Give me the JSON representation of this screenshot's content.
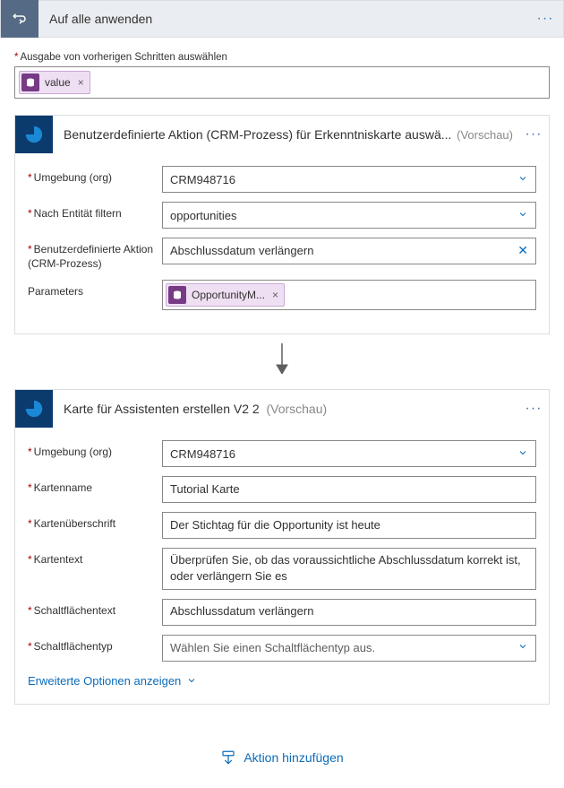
{
  "outer": {
    "title": "Auf alle anwenden",
    "prev_output_label": "Ausgabe von vorherigen Schritten auswählen",
    "token_label": "value"
  },
  "card1": {
    "title": "Benutzerdefinierte Aktion (CRM-Prozess) für Erkenntniskarte auswä...",
    "preview": "(Vorschau)",
    "env_label": "Umgebung (org)",
    "env_value": "CRM948716",
    "entity_label": "Nach Entität filtern",
    "entity_value": "opportunities",
    "custom_action_label": "Benutzerdefinierte Aktion (CRM-Prozess)",
    "custom_action_value": "Abschlussdatum verlängern",
    "params_label": "Parameters",
    "param_token": "OpportunityM..."
  },
  "card2": {
    "title": "Karte für Assistenten erstellen V2 2",
    "preview": "(Vorschau)",
    "env_label": "Umgebung (org)",
    "env_value": "CRM948716",
    "name_label": "Kartenname",
    "name_value": "Tutorial Karte",
    "heading_label": "Kartenüberschrift",
    "heading_value": "Der Stichtag für die Opportunity ist heute",
    "text_label": "Kartentext",
    "text_value": "Überprüfen Sie, ob das voraussichtliche Abschlussdatum korrekt ist, oder verlängern Sie es",
    "btn_text_label": "Schaltflächentext",
    "btn_text_value": "Abschlussdatum verlängern",
    "btn_type_label": "Schaltflächentyp",
    "btn_type_placeholder": "Wählen Sie einen Schaltflächentyp aus.",
    "advanced": "Erweiterte Optionen anzeigen"
  },
  "footer": {
    "add_action": "Aktion hinzufügen"
  }
}
